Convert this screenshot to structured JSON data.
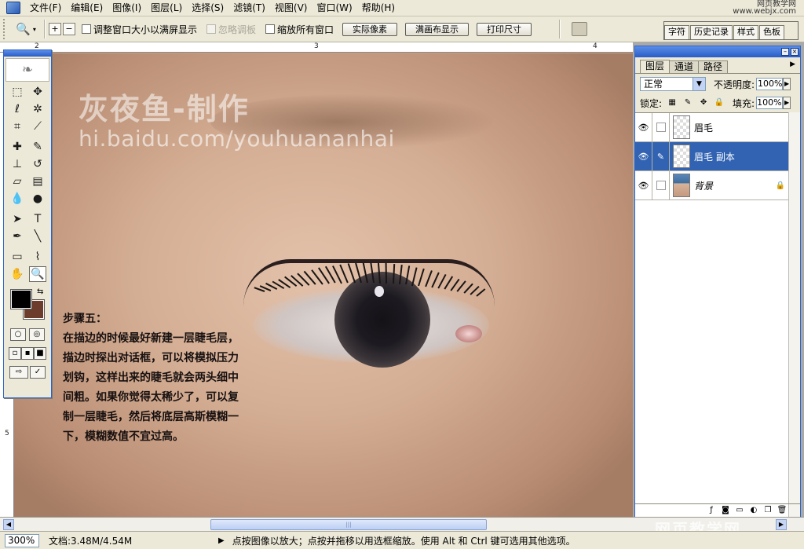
{
  "menu": [
    "文件(F)",
    "编辑(E)",
    "图像(I)",
    "图层(L)",
    "选择(S)",
    "滤镜(T)",
    "视图(V)",
    "窗口(W)",
    "帮助(H)"
  ],
  "brand": {
    "line1": "网页教学网",
    "line2": "www.webjx.com"
  },
  "options": {
    "fit_window": "调整窗口大小以满屏显示",
    "ignore_palettes": "忽略调板",
    "zoom_all": "缩放所有窗口",
    "actual_pixels": "实际像素",
    "fit_screen": "满画布显示",
    "print_size": "打印尺寸"
  },
  "palette_well": [
    "字符",
    "历史记录",
    "样式",
    "色板"
  ],
  "rulers": {
    "top": [
      "2",
      "3",
      "4"
    ],
    "left": [
      "5"
    ]
  },
  "canvas": {
    "watermark_title": "灰夜鱼-制作",
    "watermark_url": "hi.baidu.com/youhuananhai",
    "step_title": "步骤五：",
    "step_lines": [
      "在描边的时候最好新建一层睫毛层，",
      "描边时探出对话框，可以将模拟压力",
      "划钩，这样出来的睫毛就会两头细中",
      "间粗。如果你觉得太稀少了，可以复",
      "制一层睫毛，然后将底层高斯模糊一",
      "下，模糊数值不宜过高。"
    ]
  },
  "layers_panel": {
    "tabs": [
      "图层",
      "通道",
      "路径"
    ],
    "blend_mode": "正常",
    "opacity_label": "不透明度:",
    "opacity": "100%",
    "lock_label": "锁定:",
    "fill_label": "填充:",
    "fill": "100%",
    "layers": [
      {
        "name": "眉毛",
        "selected": false
      },
      {
        "name": "眉毛 副本",
        "selected": true
      },
      {
        "name": "背景",
        "selected": false
      }
    ]
  },
  "scroll_watermark": "网页教学网",
  "status": {
    "zoom": "300%",
    "doc": "文档:3.48M/4.54M",
    "message": "点按图像以放大；点按并拖移以用选框缩放。使用 Alt 和 Ctrl 键可选用其他选项。"
  },
  "colors": {
    "foreground": "#000000",
    "background": "#6c3c2c",
    "selection": "#3163b2"
  }
}
